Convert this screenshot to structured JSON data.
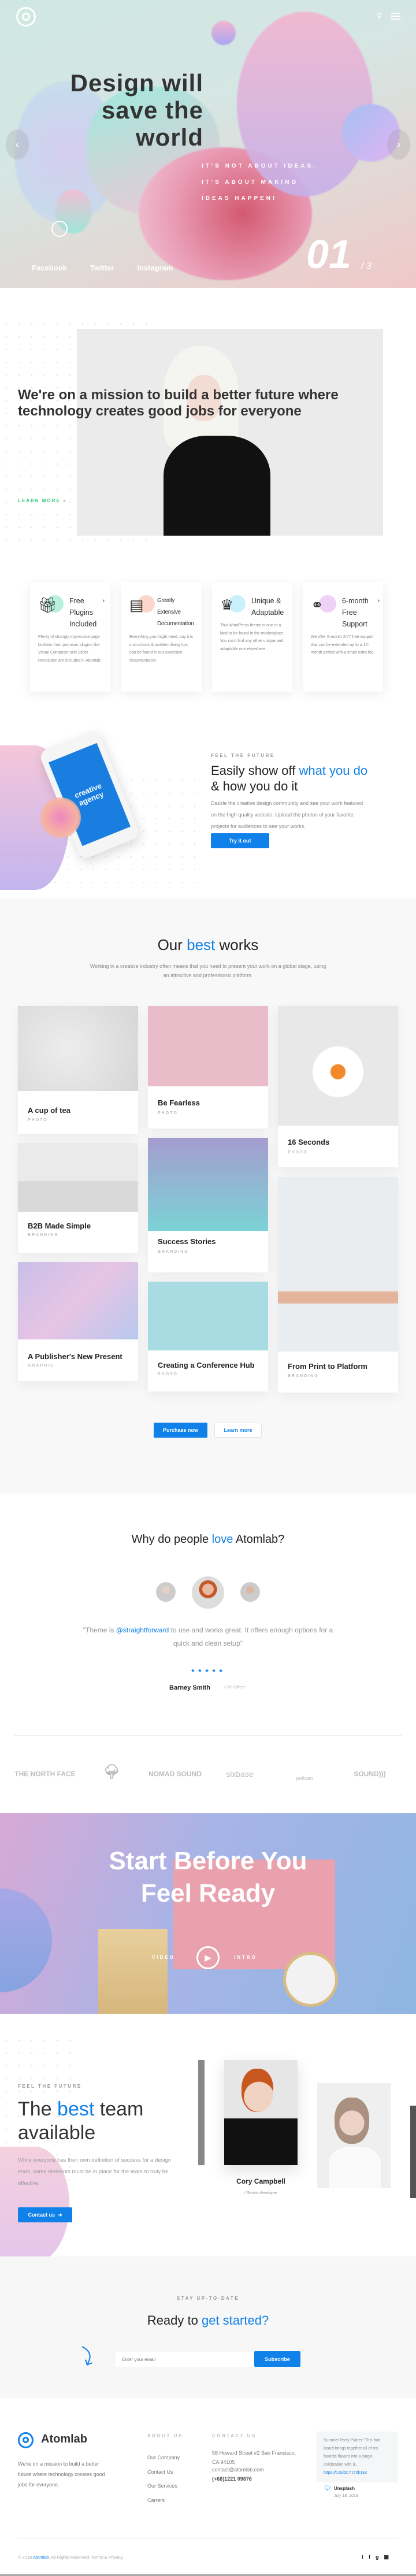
{
  "hero": {
    "title_lines": [
      "Design will",
      "save the",
      "world"
    ],
    "subtitle_lines": [
      "IT'S NOT ABOUT IDEAS.",
      "IT'S ABOUT MAKING",
      "IDEAS HAPPEN!"
    ],
    "social": [
      "Facebook",
      "Twitter",
      "Instagram"
    ],
    "slide_current": "01",
    "slide_total": "/ 3"
  },
  "mission": {
    "headline": "We're on a mission to build a better future where technology creates good jobs for everyone",
    "learn_more": "LEARN MORE"
  },
  "features": [
    {
      "title": "Free\nPlugins\nIncluded",
      "desc": "Plenty of strongly impressive page builders from premium plugins like Visual Composer and Slider Revolution are included in Atomlab.",
      "icon": "gift-icon",
      "color": "#b8f0dc"
    },
    {
      "title": "Greatly\nExtensive\nDocumentation",
      "desc": "Everything you might need, say it is instructions & problem-fixing tips, can be found in our extensive documentation.",
      "icon": "server-icon",
      "color": "#fbd6cc"
    },
    {
      "title": "Unique &\nAdaptable",
      "desc": "This WordPress theme is one of a kind to be found in the marketplace. You can't find any other unique and adaptable one elsewhere.",
      "icon": "crown-icon",
      "color": "#c9f1fb"
    },
    {
      "title": "6-month\nFree\nSupport",
      "desc": "We offer 6-month 24/7 free support that can be extended up to a 12-month period with a small extra fee.",
      "icon": "headset-icon",
      "color": "#efd0f6"
    }
  ],
  "showoff": {
    "label": "FEEL THE FUTURE",
    "heading_pre": "Easily show off ",
    "heading_hl": "what you do",
    "heading_post": " & how you do it",
    "body": "Dazzle the creative design community and see your work featured on the high-quality website. Upload the photos of your favorite projects for audiences to see your works.",
    "button": "Try it out",
    "phone_text": "creative agency"
  },
  "works": {
    "title_pre": "Our ",
    "title_hl": "best",
    "title_post": " works",
    "subtitle": "Working in a creative industry often means that you need to present your work on a global stage, using an attractive and professional platform.",
    "items": [
      {
        "title": "A cup of tea",
        "category": "PHOTO"
      },
      {
        "title": "B2B Made Simple",
        "category": "BRANDING"
      },
      {
        "title": "A Publisher's New Present",
        "category": "GRAPHIC"
      },
      {
        "title": "Be Fearless",
        "category": "PHOTO"
      },
      {
        "title": "Success Stories",
        "category": "BRANDING"
      },
      {
        "title": "Creating a Conference Hub",
        "category": "PHOTO"
      },
      {
        "title": "16 Seconds",
        "category": "PHOTO"
      },
      {
        "title": "From Print to Platform",
        "category": "BRANDING"
      }
    ],
    "purchase": "Purchase now",
    "learn": "Learn more"
  },
  "testimonials": {
    "title_pre": "Why do people ",
    "title_hl": "love",
    "title_post": " Atomlab?",
    "quote_pre": "\"Theme is ",
    "quote_hl": "@straightforward",
    "quote_post": " to use and works great. It offers enough options for a quick and clean setup\"",
    "stars": 5,
    "name": "Barney Smith",
    "role": "/ PR Officer"
  },
  "logos": [
    "THE NORTH FACE",
    "tree",
    "NOMAD SOUND",
    "sixbase",
    "pelican",
    "SOUND)))"
  ],
  "video": {
    "title_lines": [
      "Start Before You",
      "Feel Ready"
    ],
    "left": "VIDEO",
    "right": "INTRO"
  },
  "team": {
    "label": "FEEL THE FUTURE",
    "heading_pre": "The ",
    "heading_hl": "best",
    "heading_post": " team available",
    "body": "While everyone has their own definition of success for a design team, some elements must be in place for the team to truly be effective.",
    "button": "Contact us",
    "member_name": "Cory Campbell",
    "member_role": "/ Senior developer"
  },
  "cta": {
    "label": "STAY UP-TO-DATE",
    "heading_pre": "Ready to ",
    "heading_hl": "get started?",
    "placeholder": "Enter your email",
    "button": "Subscribe"
  },
  "footer": {
    "brand": "Atomlab",
    "desc": "We're on a mission to build a better future where technology creates good jobs for everyone.",
    "about_label": "ABOUT US",
    "about_links": [
      "Our Company",
      "Contact Us",
      "Our Services",
      "Carrers"
    ],
    "contact_label": "CONTACT US",
    "address": "58 Howard Street #2 San Francisco, CA 94105",
    "email": "contact@atomlab.com",
    "phone": "(+68)1221 09876",
    "tweet_text": "Summer Party Platter \"This fruit board brings together all of my favorite flavors into a single celebration with ri... ",
    "tweet_link": "https://t.co/bCY1Tdk1Ec",
    "tweet_user": "Unsplash",
    "tweet_date": "July 18, 2018",
    "copy_pre": "© 2018 ",
    "copy_brand": "Atomlab",
    "copy_post": ". All Rights Reserved. Terms & Privacy.",
    "accent": "#1081e8"
  }
}
